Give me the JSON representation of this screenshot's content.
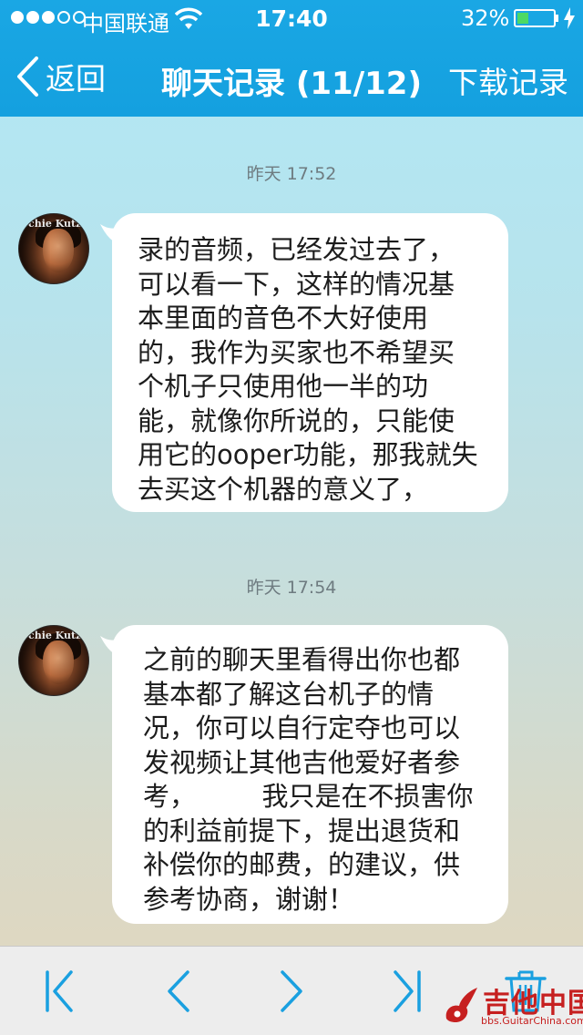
{
  "status_bar": {
    "carrier": "中国联通",
    "time": "17:40",
    "battery_percent_text": "32%",
    "battery_level": 0.32
  },
  "nav": {
    "back_label": "返回",
    "title": "聊天记录 (11/12)",
    "right_label": "下载记录"
  },
  "messages": [
    {
      "timestamp": "昨天 17:52",
      "avatar_text": "chie Kutz",
      "text": "录的音频，已经发过去了，\n可以看一下，这样的情况基\n本里面的音色不大好使用\n的，我作为买家也不希望买\n个机子只使用他一半的功\n能，就像你所说的，只能使\n用它的ooper功能，那我就失\n去买这个机器的意义了，"
    },
    {
      "timestamp": "昨天 17:54",
      "avatar_text": "chie Kutz",
      "text": "之前的聊天里看得出你也都\n基本都了解这台机子的情\n况，你可以自行定夺也可以\n发视频让其他吉他爱好者参\n考，　　　我只是在不损害你\n的利益前提下，提出退货和\n补偿你的邮费，的建议，供\n参考协商，谢谢！"
    }
  ],
  "toolbar": {
    "icons": [
      "first-page-icon",
      "previous-page-icon",
      "next-page-icon",
      "last-page-icon",
      "trash-icon"
    ]
  },
  "watermark": {
    "main": "吉他中国",
    "sub": "bbs.GuitarChina.com"
  },
  "colors": {
    "accent": "#14a0df",
    "toolbar_icon": "#1aa0e0",
    "battery_fill": "#4cd964",
    "watermark": "#c62020"
  }
}
